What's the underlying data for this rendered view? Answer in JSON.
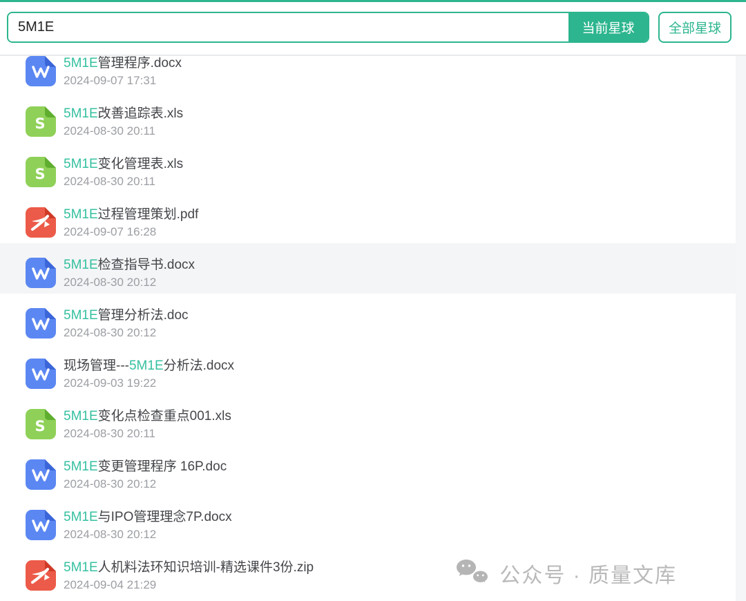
{
  "theme": {
    "accent": "#2cb58e",
    "highlight": "#35c0a0",
    "file_icons": {
      "word": {
        "body": "#5b87f2",
        "fold": "#3b66d9"
      },
      "excel": {
        "body": "#8fd158",
        "fold": "#5fae2f"
      },
      "pdf": {
        "body": "#ec5b49",
        "fold": "#cf3a28"
      }
    }
  },
  "search": {
    "query": "5M1E",
    "scope_current": "当前星球",
    "scope_all": "全部星球"
  },
  "files": [
    {
      "type": "word",
      "hovered": false,
      "date": "2024-09-07 17:31",
      "name_parts": [
        {
          "text": "5M1E",
          "highlight": true
        },
        {
          "text": "管理程序.docx",
          "highlight": false
        }
      ]
    },
    {
      "type": "excel",
      "hovered": false,
      "date": "2024-08-30 20:11",
      "name_parts": [
        {
          "text": "5M1E",
          "highlight": true
        },
        {
          "text": "改善追踪表.xls",
          "highlight": false
        }
      ]
    },
    {
      "type": "excel",
      "hovered": false,
      "date": "2024-08-30 20:11",
      "name_parts": [
        {
          "text": "5M1E",
          "highlight": true
        },
        {
          "text": "变化管理表.xls",
          "highlight": false
        }
      ]
    },
    {
      "type": "pdf",
      "hovered": false,
      "date": "2024-09-07 16:28",
      "name_parts": [
        {
          "text": "5M1E",
          "highlight": true
        },
        {
          "text": "过程管理策划.pdf",
          "highlight": false
        }
      ]
    },
    {
      "type": "word",
      "hovered": true,
      "date": "2024-08-30 20:12",
      "name_parts": [
        {
          "text": "5M1E",
          "highlight": true
        },
        {
          "text": "检查指导书.docx",
          "highlight": false
        }
      ]
    },
    {
      "type": "word",
      "hovered": false,
      "date": "2024-08-30 20:12",
      "name_parts": [
        {
          "text": "5M1E",
          "highlight": true
        },
        {
          "text": "管理分析法.doc",
          "highlight": false
        }
      ]
    },
    {
      "type": "word",
      "hovered": false,
      "date": "2024-09-03 19:22",
      "name_parts": [
        {
          "text": "现场管理---",
          "highlight": false
        },
        {
          "text": "5M1E",
          "highlight": true
        },
        {
          "text": "分析法.docx",
          "highlight": false
        }
      ]
    },
    {
      "type": "excel",
      "hovered": false,
      "date": "2024-08-30 20:11",
      "name_parts": [
        {
          "text": "5M1E",
          "highlight": true
        },
        {
          "text": "变化点检查重点001.xls",
          "highlight": false
        }
      ]
    },
    {
      "type": "word",
      "hovered": false,
      "date": "2024-08-30 20:12",
      "name_parts": [
        {
          "text": "5M1E",
          "highlight": true
        },
        {
          "text": "变更管理程序 16P.doc",
          "highlight": false
        }
      ]
    },
    {
      "type": "word",
      "hovered": false,
      "date": "2024-08-30 20:12",
      "name_parts": [
        {
          "text": "5M1E",
          "highlight": true
        },
        {
          "text": "与IPO管理理念7P.docx",
          "highlight": false
        }
      ]
    },
    {
      "type": "pdf",
      "hovered": false,
      "date": "2024-09-04 21:29",
      "name_parts": [
        {
          "text": "5M1E",
          "highlight": true
        },
        {
          "text": "人机料法环知识培训-精选课件3份.zip",
          "highlight": false
        }
      ]
    }
  ],
  "watermark": {
    "icon": "wechat-icon",
    "text": "公众号 · 质量文库"
  }
}
